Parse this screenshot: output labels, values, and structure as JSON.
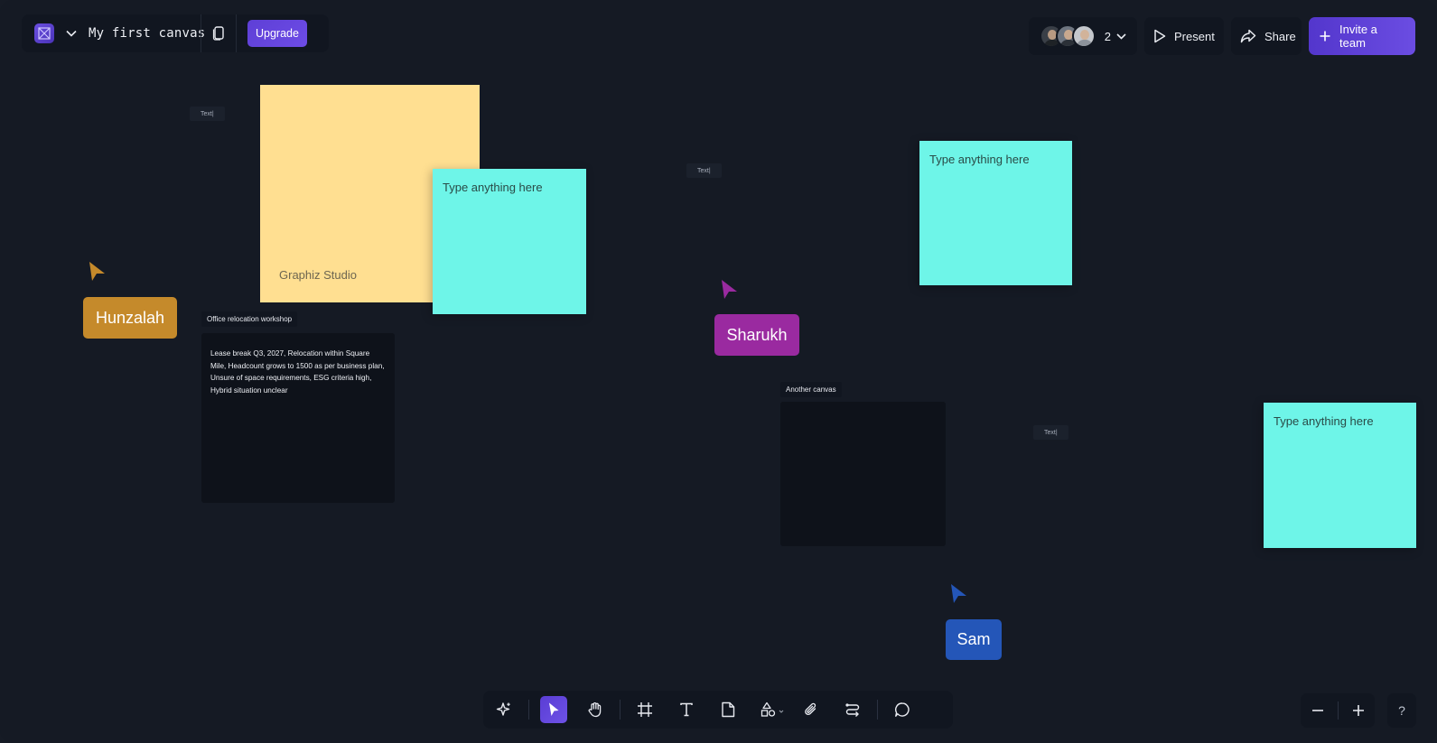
{
  "header": {
    "logo_icon": "cross-box-logo-icon",
    "canvas_title": "My first canvas",
    "upgrade_label": "Upgrade",
    "collaborator_count": "2",
    "present_label": "Present",
    "share_label": "Share",
    "invite_label": "Invite a team"
  },
  "canvas": {
    "sticky_yellow": {
      "label": "Graphiz Studio",
      "color": "#ffdf91"
    },
    "sticky_cyan": [
      {
        "text": "Type anything here"
      },
      {
        "text": "Type anything here"
      },
      {
        "text": "Type anything here"
      }
    ],
    "cyan_color": "#6ef5e8",
    "text_chips": [
      "Text|",
      "Text|",
      "Text|"
    ],
    "frames": [
      {
        "label": "Office relocation workshop",
        "content": "Lease break Q3, 2027, Relocation within Square Mile, Headcount grows to 1500 as per business plan, Unsure of space requirements, ESG criteria high, Hybrid situation unclear"
      },
      {
        "label": "Another canvas",
        "content": ""
      }
    ],
    "collaborators": [
      {
        "name": "Hunzalah",
        "color": "#c58a2b"
      },
      {
        "name": "Sharukh",
        "color": "#9a2aa0"
      },
      {
        "name": "Sam",
        "color": "#2456b8"
      }
    ]
  },
  "toolbar": {
    "tools": [
      "ai-sparkle-icon",
      "select-pointer-icon",
      "hand-pan-icon",
      "frame-icon",
      "text-icon",
      "sticky-note-icon",
      "shapes-icon",
      "attachment-icon",
      "connector-icon",
      "comment-icon"
    ],
    "active_tool": "select-pointer-icon"
  },
  "zoom": {
    "out_icon": "minus-icon",
    "in_icon": "plus-icon",
    "help_label": "?"
  },
  "accent_color": "#6b4de2"
}
